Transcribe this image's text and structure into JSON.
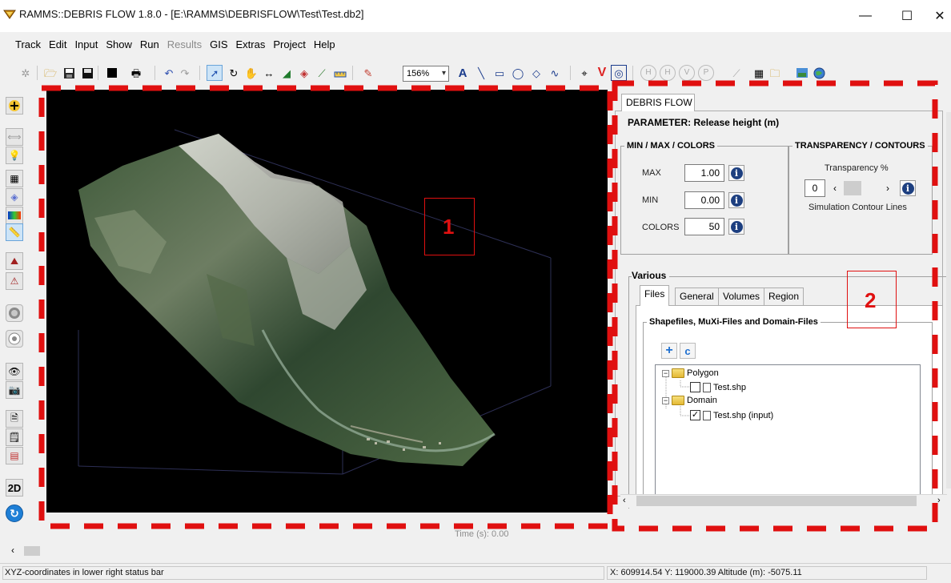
{
  "window": {
    "title": "RAMMS::DEBRIS FLOW 1.8.0  - [E:\\RAMMS\\DEBRISFLOW\\Test\\Test.db2]",
    "minimize": "—",
    "maximize": "☐",
    "close": "✕"
  },
  "menubar": {
    "items": [
      {
        "label": "Track",
        "enabled": true
      },
      {
        "label": "Edit",
        "enabled": true
      },
      {
        "label": "Input",
        "enabled": true
      },
      {
        "label": "Show",
        "enabled": true
      },
      {
        "label": "Run",
        "enabled": true
      },
      {
        "label": "Results",
        "enabled": false
      },
      {
        "label": "GIS",
        "enabled": true
      },
      {
        "label": "Extras",
        "enabled": true
      },
      {
        "label": "Project",
        "enabled": true
      },
      {
        "label": "Help",
        "enabled": true
      }
    ]
  },
  "toolbar": {
    "zoom_value": "156%",
    "text_tool_glyph": "A",
    "h_glyph": "H",
    "v_glyph": "V",
    "p_glyph": "P"
  },
  "left_toolbar": {
    "view_2d_label": "2D"
  },
  "panel": {
    "tab_label": "DEBRIS FLOW",
    "parameter_title": "PARAMETER: Release height (m)",
    "minmax": {
      "legend": "MIN / MAX / COLORS",
      "max_label": "MAX",
      "max_value": "1.00",
      "min_label": "MIN",
      "min_value": "0.00",
      "colors_label": "COLORS",
      "colors_value": "50"
    },
    "transparency": {
      "legend": "TRANSPARENCY / CONTOURS",
      "transparency_label": "Transparency %",
      "transparency_value": "0",
      "contour_label": "Simulation Contour Lines"
    },
    "various": {
      "legend": "Various",
      "tabs": [
        "Files",
        "General",
        "Volumes",
        "Region"
      ],
      "active_tab": "Files",
      "files_group_legend": "Shapefiles, MuXi-Files and Domain-Files",
      "tree": {
        "polygon_folder": "Polygon",
        "polygon_file": "Test.shp",
        "polygon_checked": false,
        "domain_folder": "Domain",
        "domain_file": "Test.shp (input)",
        "domain_checked": true
      }
    }
  },
  "info_glyph": "i",
  "annotations": {
    "label_1": "1",
    "label_2": "2"
  },
  "bottom": {
    "time_label": "Time (s): 0.00",
    "status_left": "XYZ-coordinates in lower right status bar",
    "status_right": "X: 609914.54 Y: 119000.39 Altitude (m): -5075.11"
  },
  "colors": {
    "annotation_red": "#e01010",
    "viewport_bg": "#000000",
    "info_blue": "#1d3f80"
  }
}
